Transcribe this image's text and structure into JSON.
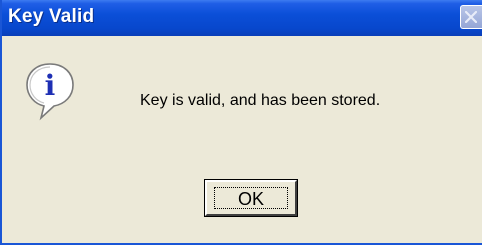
{
  "window": {
    "title": "Key Valid",
    "close_icon": "close-icon"
  },
  "dialog": {
    "icon": "information-icon",
    "icon_glyph": "i",
    "message": "Key is valid, and has been stored."
  },
  "buttons": {
    "ok_label": "OK"
  },
  "colors": {
    "titlebar": "#0b4fd8",
    "background": "#ece9d8",
    "info_icon_text": "#1e2fb4"
  }
}
